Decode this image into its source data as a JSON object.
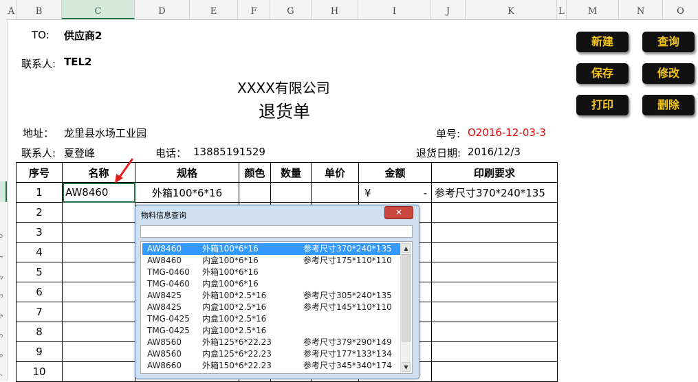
{
  "columns": [
    "A",
    "B",
    "C",
    "D",
    "E",
    "F",
    "G",
    "H",
    "I",
    "J",
    "K",
    "L",
    "M",
    "N",
    "O"
  ],
  "rows": [
    "0",
    "1",
    "2",
    "3",
    "4",
    "5",
    "6",
    "7"
  ],
  "header": {
    "to_label": "TO:",
    "to_value": "供应商2",
    "contact_label": "联系人:",
    "contact_value": "TEL2",
    "company": "XXXX有限公司",
    "doc_title": "退货单",
    "address_label": "地址：",
    "address_value": "龙里县水场工业园",
    "order_no_label": "单号:",
    "order_no_value": "O2016-12-03-3",
    "contact2_label": "联系人:",
    "contact2_value": "夏登峰",
    "phone_label": "电话：",
    "phone_value": "13885191529",
    "return_date_label": "退货日期:",
    "return_date_value": "2016/12/3"
  },
  "table": {
    "headers": [
      "序号",
      "名称",
      "规格",
      "颜色",
      "数量",
      "单价",
      "金额",
      "印刷要求"
    ],
    "first_row": {
      "no": "1",
      "name": "AW8460",
      "spec": "外箱100*6*16",
      "amount_symbol": "¥",
      "amount_value": "-",
      "print_req": "参考尺寸370*240*135"
    },
    "row_numbers": [
      "2",
      "3",
      "4",
      "5",
      "6",
      "7",
      "8",
      "9",
      "10"
    ]
  },
  "buttons": {
    "new": "新建",
    "query": "查询",
    "save": "保存",
    "edit": "修改",
    "print": "打印",
    "delete": "删除"
  },
  "dialog": {
    "title": "物料信息查询",
    "close": "✕",
    "items": [
      {
        "code": "AW8460",
        "spec": "外箱100*6*16",
        "size": "参考尺寸370*240*135"
      },
      {
        "code": "AW8460",
        "spec": "内盒100*6*16",
        "size": "参考尺寸175*110*110"
      },
      {
        "code": "TMG-0460",
        "spec": "外箱100*6*16",
        "size": ""
      },
      {
        "code": "TMG-0460",
        "spec": "内盒100*6*16",
        "size": ""
      },
      {
        "code": "AW8425",
        "spec": "外箱100*2.5*16",
        "size": "参考尺寸305*240*135"
      },
      {
        "code": "AW8425",
        "spec": "内盒100*2.5*16",
        "size": "参考尺寸145*110*110"
      },
      {
        "code": "TMG-0425",
        "spec": "内盒100*2.5*16",
        "size": ""
      },
      {
        "code": "TMG-0425",
        "spec": "内盒100*2.5*16",
        "size": ""
      },
      {
        "code": "AW8560",
        "spec": "外箱125*6*22.23",
        "size": "参考尺寸379*290*149"
      },
      {
        "code": "AW8560",
        "spec": "内盒125*6*22.23",
        "size": "参考尺寸177*133*134"
      },
      {
        "code": "AW8660",
        "spec": "外箱150*6*22.23",
        "size": "参考尺寸345*340*174"
      }
    ],
    "scroll_up": "▲",
    "scroll_down": "▼"
  },
  "colors": {
    "button_bg": "#111111",
    "button_text": "#f5c518",
    "selection": "#3399ff",
    "order_no": "#e00000",
    "excel_green": "#217346"
  }
}
